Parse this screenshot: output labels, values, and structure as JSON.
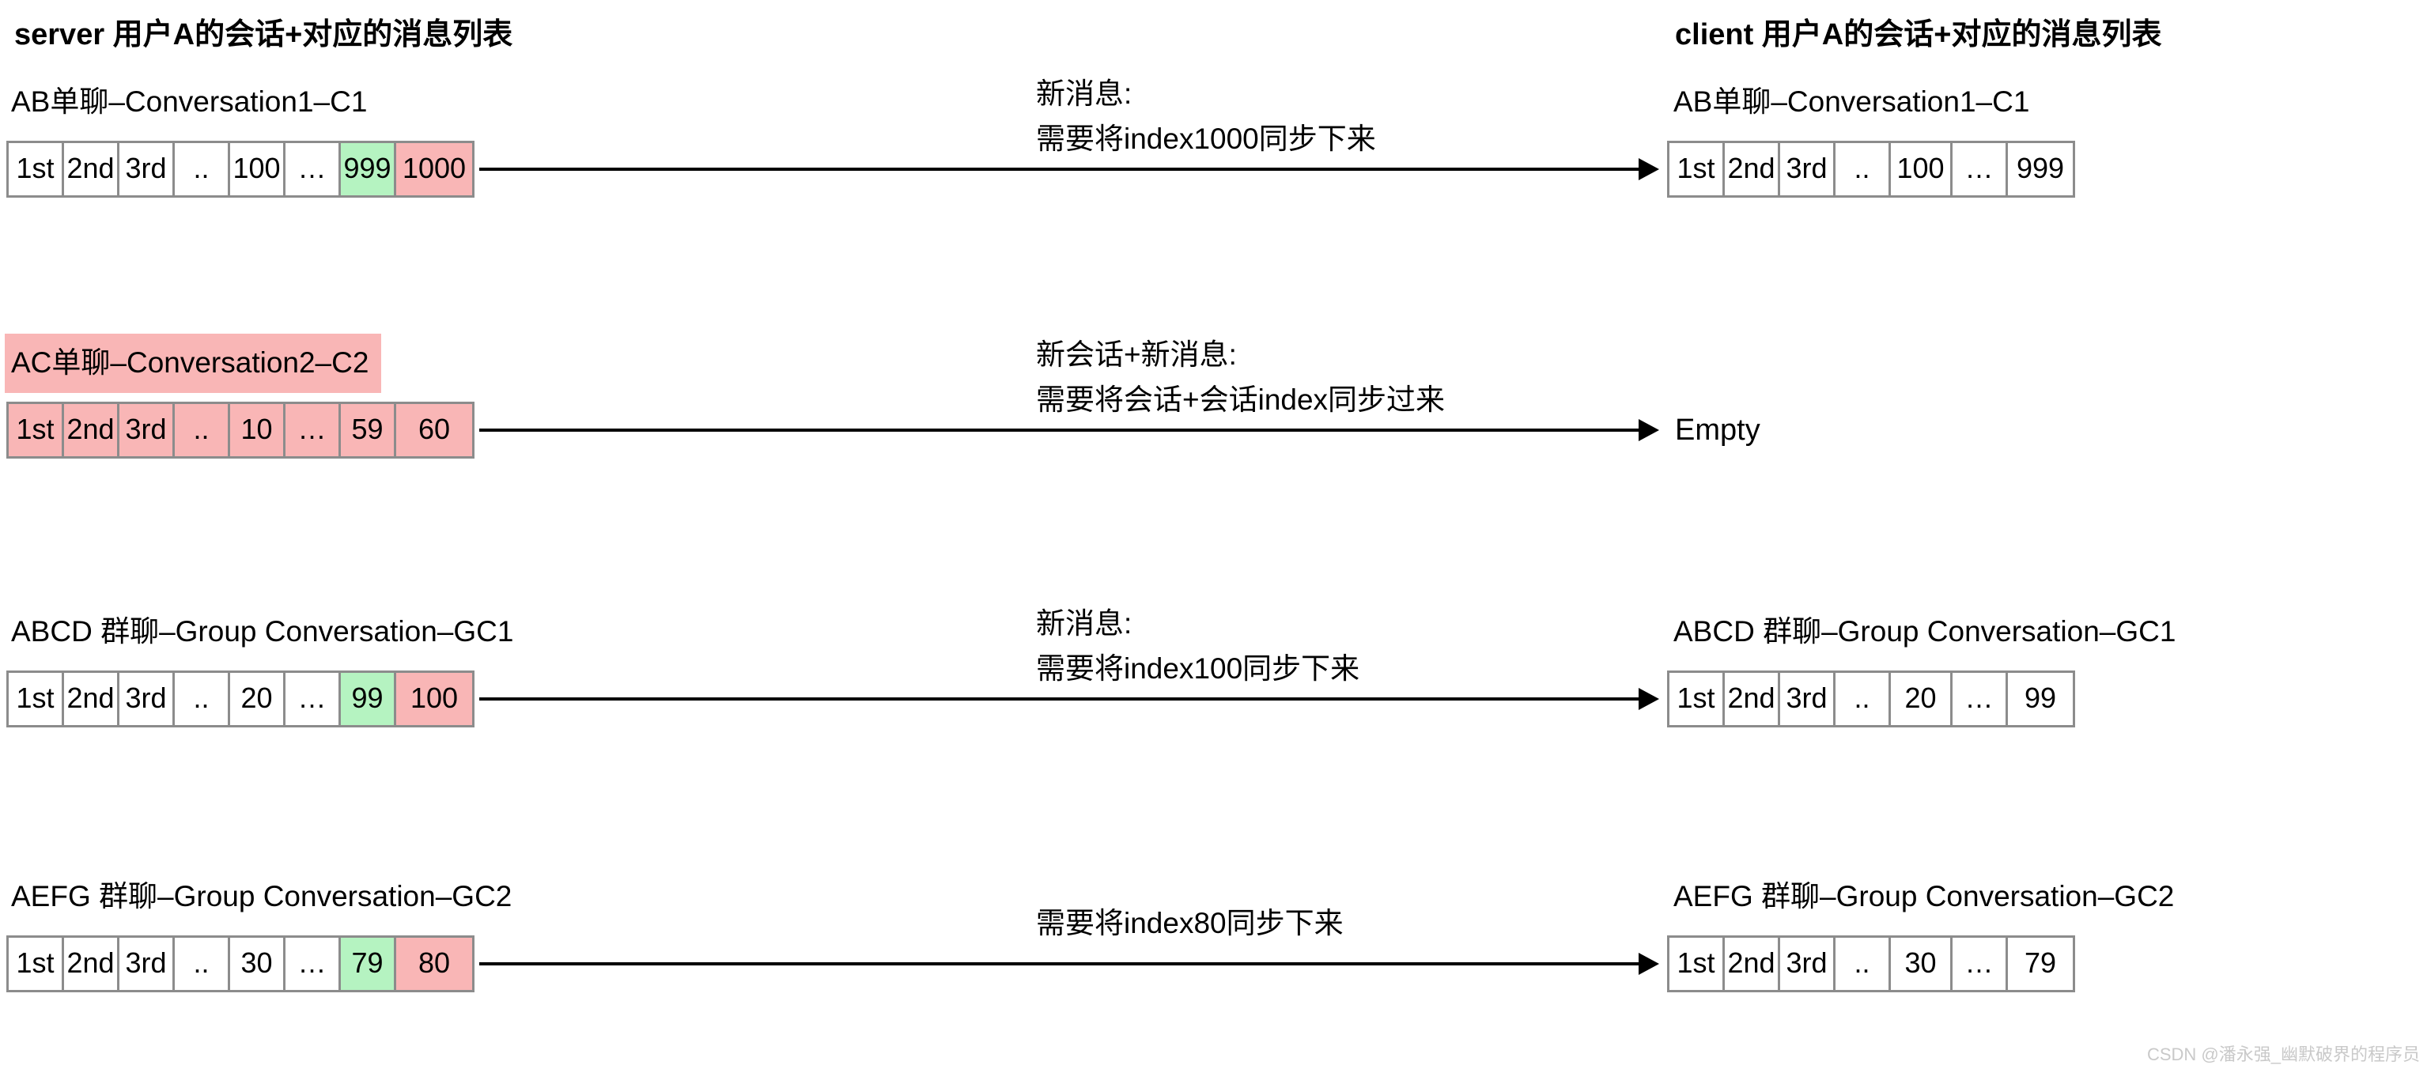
{
  "headers": {
    "server": "server 用户A的会话+对应的消息列表",
    "client": "client 用户A的会话+对应的消息列表"
  },
  "colors": {
    "green_highlight": "#b5f3c1",
    "pink_highlight": "#f9b6b6",
    "cell_border": "#8c8c8c",
    "arrow": "#000000",
    "watermark": "#c9c9c9"
  },
  "rows": [
    {
      "server_label": "AB单聊–Conversation1–C1",
      "server_label_highlight": false,
      "server_cells": [
        {
          "value": "1st",
          "fill": "white"
        },
        {
          "value": "2nd",
          "fill": "white"
        },
        {
          "value": "3rd",
          "fill": "white"
        },
        {
          "value": "..",
          "fill": "white"
        },
        {
          "value": "100",
          "fill": "white"
        },
        {
          "value": "…",
          "fill": "white"
        },
        {
          "value": "999",
          "fill": "green"
        },
        {
          "value": "1000",
          "fill": "pink"
        }
      ],
      "note": [
        "新消息:",
        "需要将index1000同步下来"
      ],
      "client_label": "AB单聊–Conversation1–C1",
      "client_empty": false,
      "client_cells": [
        {
          "value": "1st",
          "fill": "white"
        },
        {
          "value": "2nd",
          "fill": "white"
        },
        {
          "value": "3rd",
          "fill": "white"
        },
        {
          "value": "..",
          "fill": "white"
        },
        {
          "value": "100",
          "fill": "white"
        },
        {
          "value": "…",
          "fill": "white"
        },
        {
          "value": "999",
          "fill": "white"
        }
      ]
    },
    {
      "server_label": "AC单聊–Conversation2–C2",
      "server_label_highlight": true,
      "server_cells": [
        {
          "value": "1st",
          "fill": "pink"
        },
        {
          "value": "2nd",
          "fill": "pink"
        },
        {
          "value": "3rd",
          "fill": "pink"
        },
        {
          "value": "..",
          "fill": "pink"
        },
        {
          "value": "10",
          "fill": "pink"
        },
        {
          "value": "…",
          "fill": "pink"
        },
        {
          "value": "59",
          "fill": "pink"
        },
        {
          "value": "60",
          "fill": "pink"
        }
      ],
      "note": [
        "新会话+新消息:",
        "需要将会话+会话index同步过来"
      ],
      "client_label": "",
      "client_empty": true,
      "client_empty_text": "Empty",
      "client_cells": []
    },
    {
      "server_label": "ABCD 群聊–Group Conversation–GC1",
      "server_label_highlight": false,
      "server_cells": [
        {
          "value": "1st",
          "fill": "white"
        },
        {
          "value": "2nd",
          "fill": "white"
        },
        {
          "value": "3rd",
          "fill": "white"
        },
        {
          "value": "..",
          "fill": "white"
        },
        {
          "value": "20",
          "fill": "white"
        },
        {
          "value": "…",
          "fill": "white"
        },
        {
          "value": "99",
          "fill": "green"
        },
        {
          "value": "100",
          "fill": "pink"
        }
      ],
      "note": [
        "新消息:",
        "需要将index100同步下来"
      ],
      "client_label": "ABCD 群聊–Group Conversation–GC1",
      "client_empty": false,
      "client_cells": [
        {
          "value": "1st",
          "fill": "white"
        },
        {
          "value": "2nd",
          "fill": "white"
        },
        {
          "value": "3rd",
          "fill": "white"
        },
        {
          "value": "..",
          "fill": "white"
        },
        {
          "value": "20",
          "fill": "white"
        },
        {
          "value": "…",
          "fill": "white"
        },
        {
          "value": "99",
          "fill": "white"
        }
      ]
    },
    {
      "server_label": "AEFG 群聊–Group Conversation–GC2",
      "server_label_highlight": false,
      "server_cells": [
        {
          "value": "1st",
          "fill": "white"
        },
        {
          "value": "2nd",
          "fill": "white"
        },
        {
          "value": "3rd",
          "fill": "white"
        },
        {
          "value": "..",
          "fill": "white"
        },
        {
          "value": "30",
          "fill": "white"
        },
        {
          "value": "…",
          "fill": "white"
        },
        {
          "value": "79",
          "fill": "green"
        },
        {
          "value": "80",
          "fill": "pink"
        }
      ],
      "note": [
        "需要将index80同步下来"
      ],
      "client_label": "AEFG 群聊–Group Conversation–GC2",
      "client_empty": false,
      "client_cells": [
        {
          "value": "1st",
          "fill": "white"
        },
        {
          "value": "2nd",
          "fill": "white"
        },
        {
          "value": "3rd",
          "fill": "white"
        },
        {
          "value": "..",
          "fill": "white"
        },
        {
          "value": "30",
          "fill": "white"
        },
        {
          "value": "…",
          "fill": "white"
        },
        {
          "value": "79",
          "fill": "white"
        }
      ]
    }
  ],
  "watermark": "CSDN @潘永强_幽默破界的程序员"
}
